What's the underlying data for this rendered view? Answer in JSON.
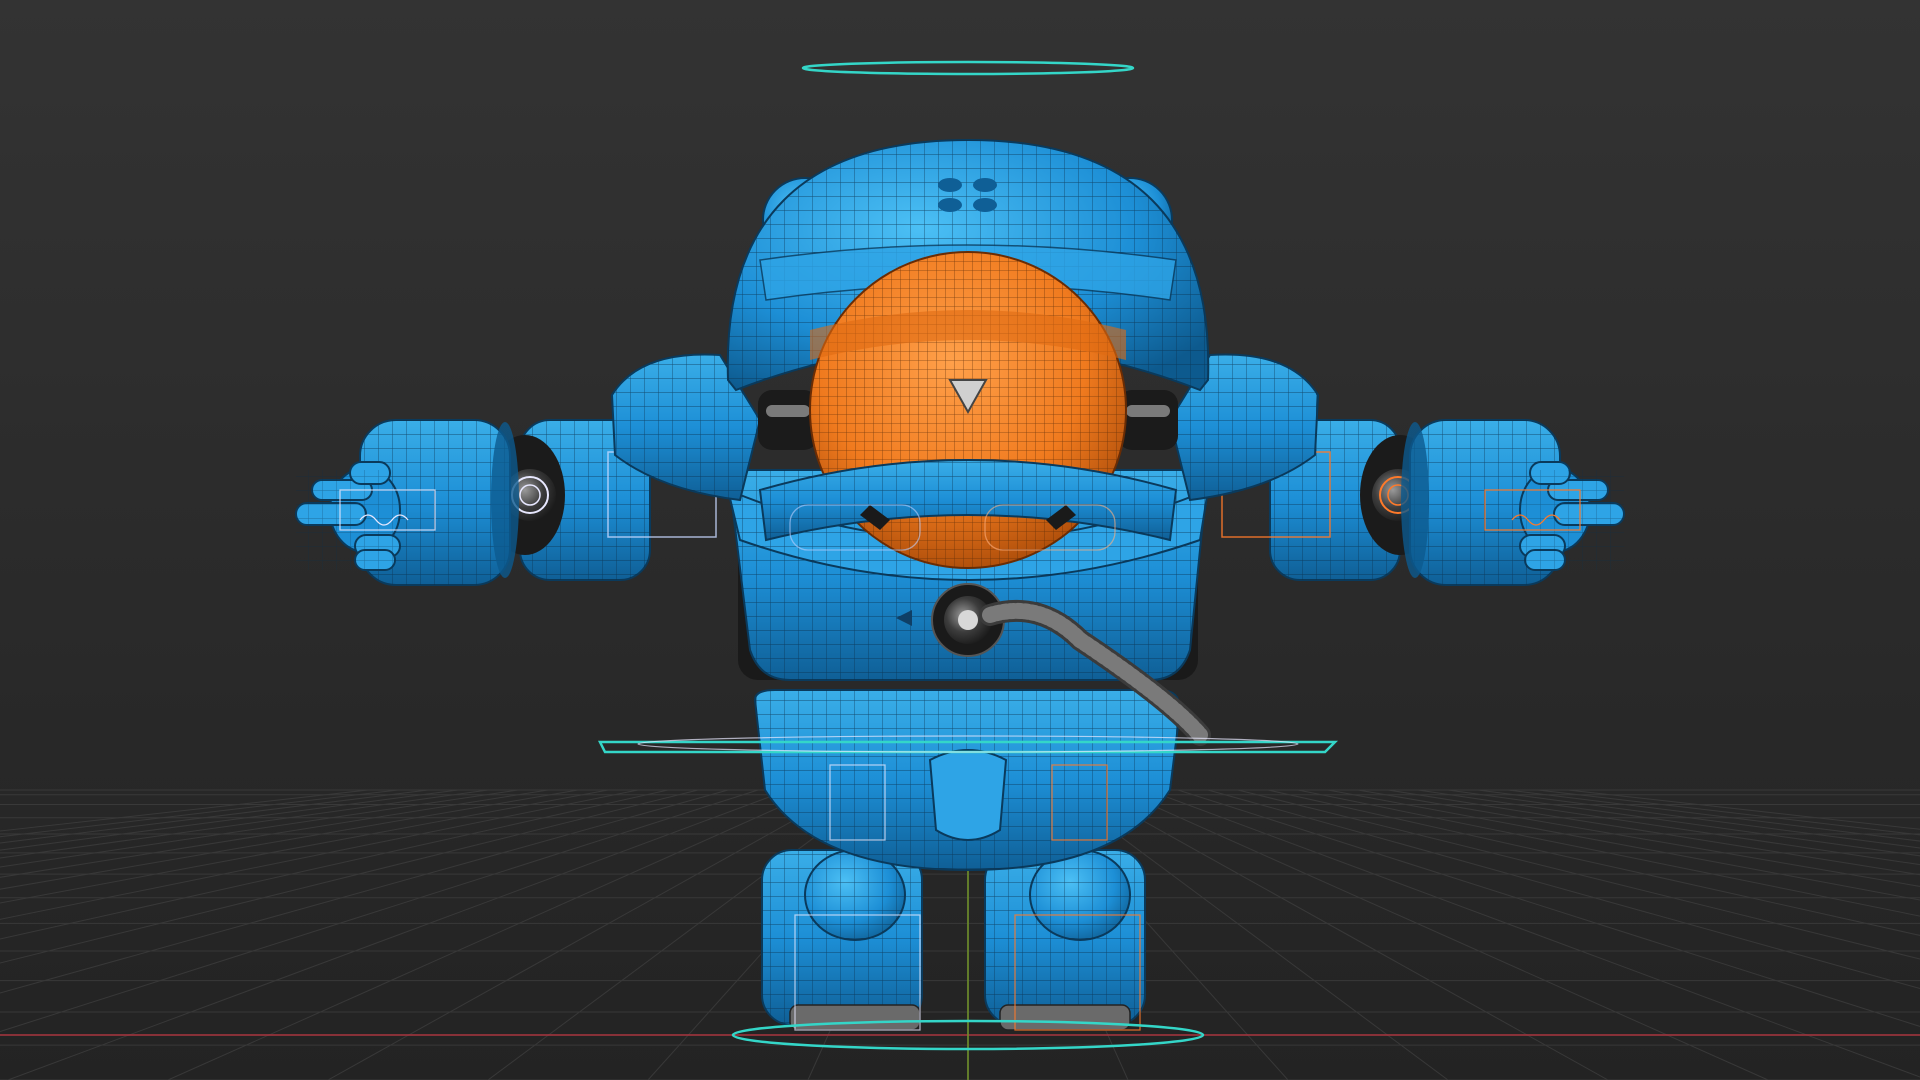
{
  "scene": {
    "description_visible_text": "",
    "colors": {
      "background_top": "#303030",
      "background_bottom": "#222222",
      "grid_line": "#3a3a3a",
      "axis_x": "#a2353e",
      "axis_y": "#6e8f2a",
      "armor_blue": "#1d8fd6",
      "armor_blue_light": "#3db0f0",
      "armor_blue_dark": "#0f5f96",
      "wire": "#0a2f4a",
      "visor_orange": "#f07a1e",
      "visor_orange_dark": "#b8520a",
      "joint_dark": "#1e1e1e",
      "joint_grey": "#8a8a8a",
      "rig_cyan": "#34d6c8",
      "rig_white": "#e8e8ff",
      "rig_orange": "#ff7a2a"
    },
    "objects": [
      "head-control-ring",
      "helmet",
      "visor",
      "torso",
      "chest-port",
      "hose",
      "left-arm",
      "right-arm",
      "left-hand",
      "right-hand",
      "hip-control-ring",
      "pelvis",
      "left-leg",
      "right-leg",
      "root-control-ring",
      "floor-grid"
    ]
  }
}
